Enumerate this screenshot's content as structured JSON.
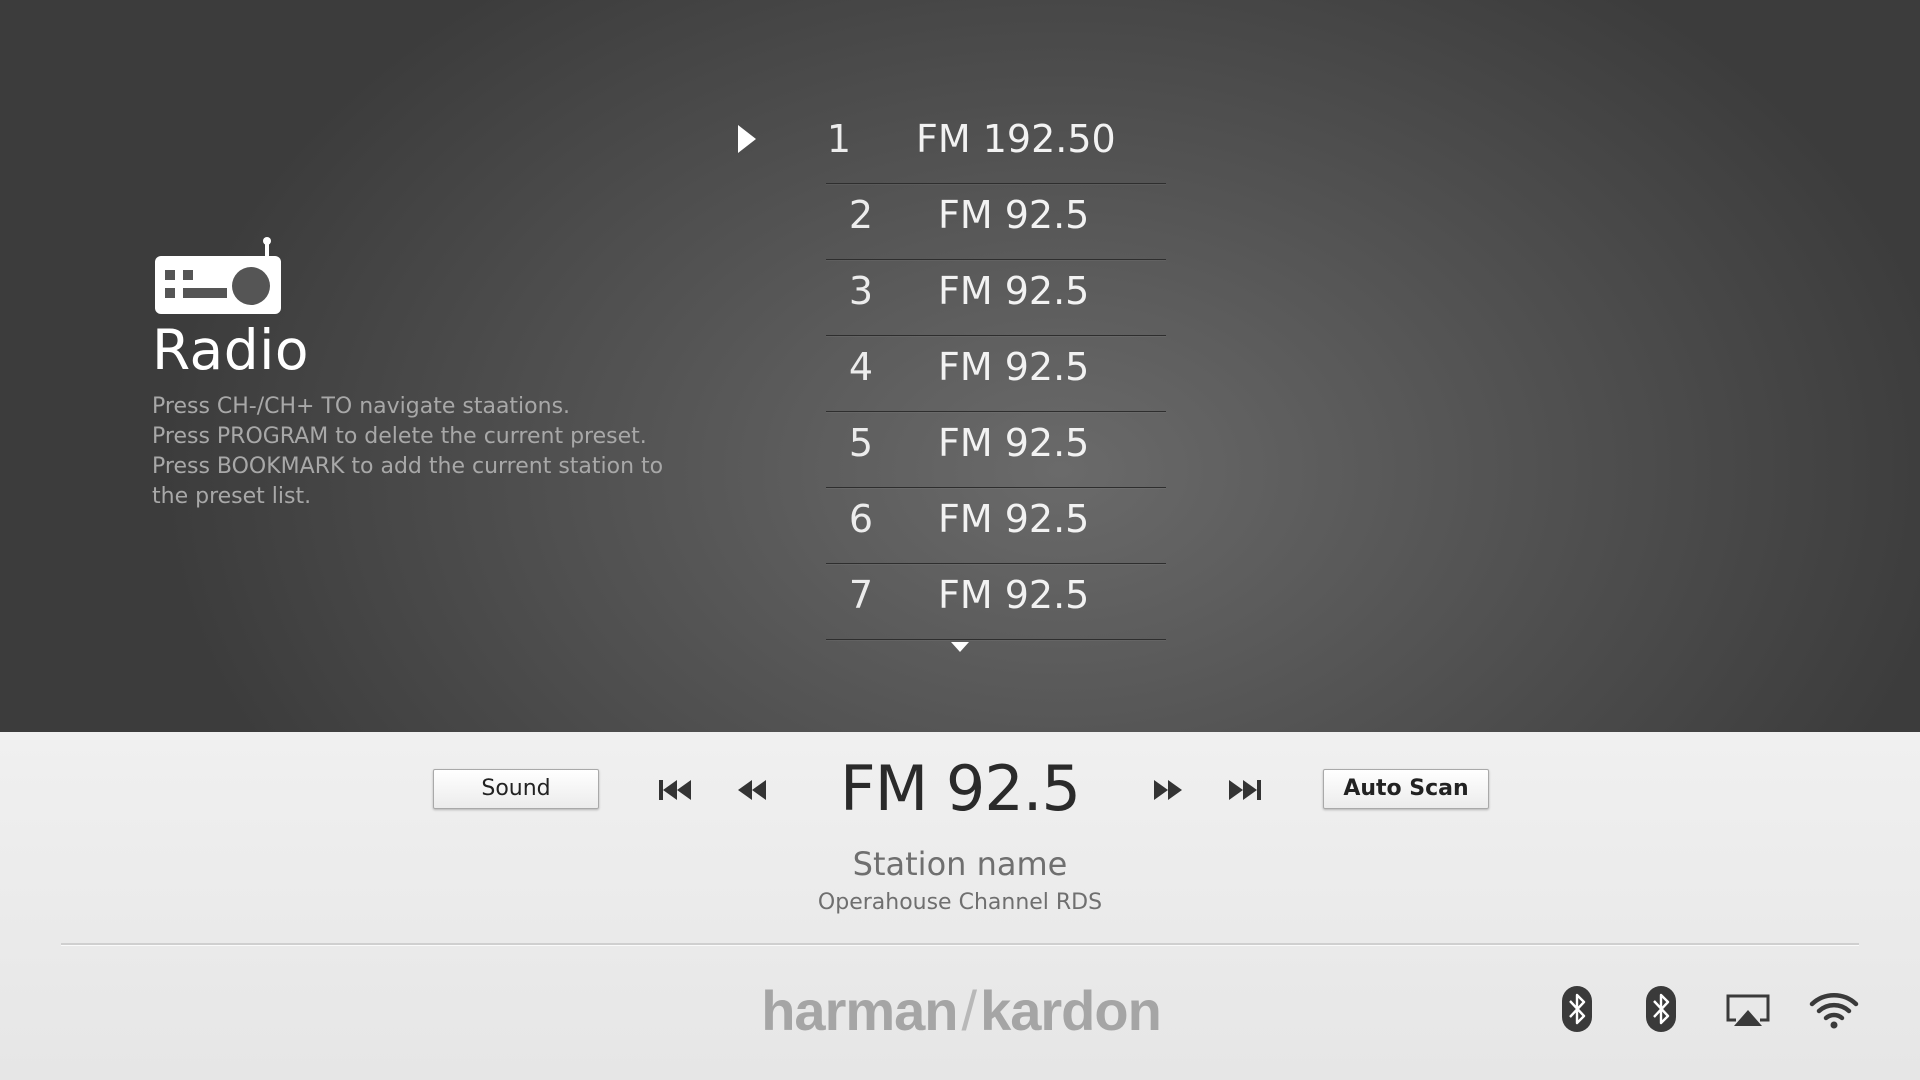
{
  "left_panel": {
    "title": "Radio",
    "icon": "radio-icon",
    "instructions": [
      "Press CH-/CH+ TO navigate staations.",
      "Press PROGRAM to delete the current preset.",
      "Press BOOKMARK to add the current station to",
      "the preset list."
    ]
  },
  "presets": [
    {
      "number": "1",
      "frequency": "FM 192.50"
    },
    {
      "number": "2",
      "frequency": "FM 92.5"
    },
    {
      "number": "3",
      "frequency": "FM 92.5"
    },
    {
      "number": "4",
      "frequency": "FM 92.5"
    },
    {
      "number": "5",
      "frequency": "FM 92.5"
    },
    {
      "number": "6",
      "frequency": "FM 92.5"
    },
    {
      "number": "7",
      "frequency": "FM 92.5"
    }
  ],
  "player": {
    "sound_label": "Sound",
    "auto_scan_label": "Auto Scan",
    "current_frequency": "FM 92.5",
    "station_name": "Station name",
    "station_rds": "Operahouse Channel RDS"
  },
  "footer": {
    "brand_left": "harman",
    "brand_slash": "/",
    "brand_right": "kardon",
    "status_icons": [
      "bluetooth-icon",
      "bluetooth-icon",
      "airplay-icon",
      "wifi-icon"
    ]
  },
  "colors": {
    "top_background": "#4a4a4a",
    "bottom_background": "#ebebeb",
    "text_light": "#ffffff",
    "text_dim": "#a8a8a8",
    "icon_dark": "#333333"
  }
}
